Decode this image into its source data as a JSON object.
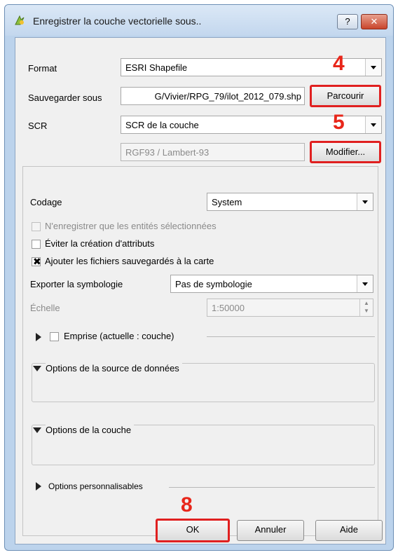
{
  "window": {
    "title": "Enregistrer la couche vectorielle sous..",
    "help_glyph": "?",
    "close_glyph": "✕"
  },
  "form": {
    "format_label": "Format",
    "format_value": "ESRI Shapefile",
    "save_as_label": "Sauvegarder sous",
    "save_as_value": "G/Vivier/RPG_79/ilot_2012_079.shp",
    "browse_button": "Parcourir",
    "crs_label": "SCR",
    "crs_value": "SCR de la couche",
    "crs_detail_value": "RGF93 / Lambert-93",
    "modify_button": "Modifier..."
  },
  "options": {
    "encoding_label": "Codage",
    "encoding_value": "System",
    "selected_only_label": "N'enregistrer que les entités sélectionnées",
    "avoid_attrs_label": "Éviter la création d'attributs",
    "add_to_map_label": "Ajouter les fichiers sauvegardés à la carte",
    "add_to_map_checked": true,
    "symbology_label": "Exporter la symbologie",
    "symbology_value": "Pas de symbologie",
    "scale_label": "Échelle",
    "scale_value": "1:50000",
    "extent_label": "Emprise (actuelle : couche)",
    "datasource_options_label": "Options de la source de données",
    "layer_options_label": "Options de la couche",
    "custom_options_label": "Options personnalisables"
  },
  "footer": {
    "ok": "OK",
    "cancel": "Annuler",
    "help": "Aide"
  },
  "annotations": {
    "step4": "4",
    "step5": "5",
    "step8": "8"
  },
  "colors": {
    "highlight": "#e02020",
    "annotation": "#e8261a"
  }
}
